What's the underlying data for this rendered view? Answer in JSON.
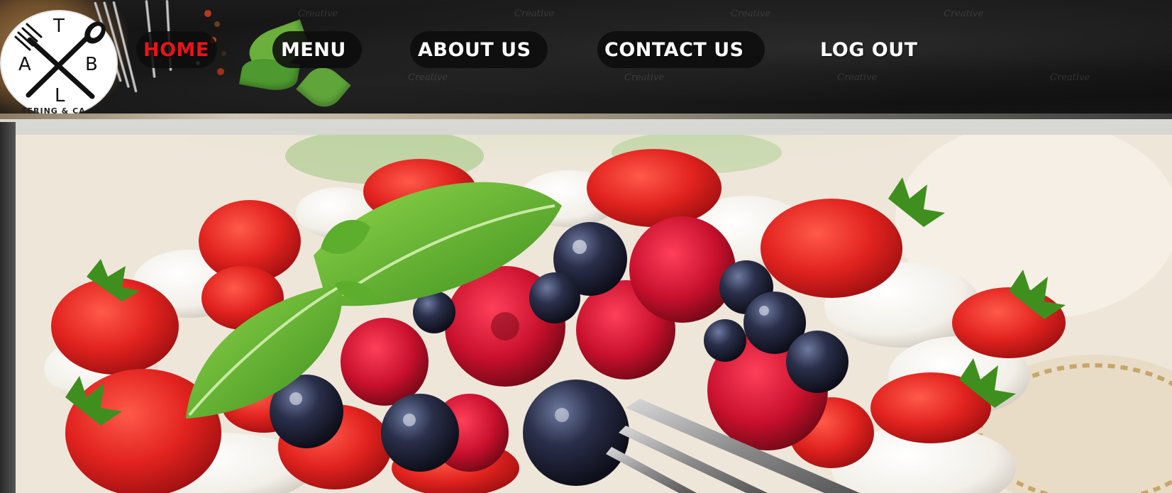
{
  "logo": {
    "letters": {
      "top": "T",
      "left": "A",
      "right": "B",
      "bottom": "L"
    },
    "subtitle": "TERING & CA",
    "icon": "crossed-fork-spoon-icon"
  },
  "nav": {
    "items": [
      {
        "label": "HOME",
        "active": true
      },
      {
        "label": "MENU",
        "active": false
      },
      {
        "label": "ABOUT US",
        "active": false
      },
      {
        "label": "CONTACT US",
        "active": false
      },
      {
        "label": "LOG OUT",
        "active": false
      }
    ]
  },
  "header": {
    "watermark_text": "Creative"
  },
  "hero": {
    "image": "berry-dessert-with-cream-and-mint-photo"
  },
  "colors": {
    "active_nav": "#e8141b",
    "nav_text": "#ffffff",
    "header_bg": "#0c0c0c"
  }
}
